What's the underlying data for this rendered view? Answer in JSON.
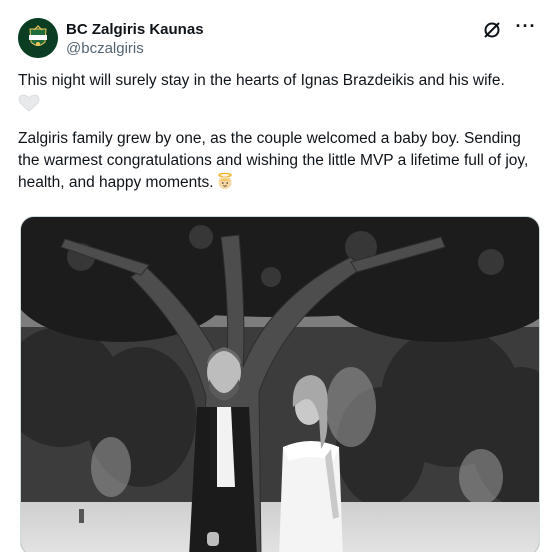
{
  "account": {
    "display_name": "BC Zalgiris Kaunas",
    "handle": "@bczalgiris",
    "avatar_text": "ZALGIRIS",
    "avatar_color": "#0b3d22"
  },
  "header_icons": {
    "grok": "grok-slash-icon",
    "more": "more-options-icon",
    "more_glyph": "···"
  },
  "tweet": {
    "paragraph1": "This night will surely stay in the hearts of Ignas Brazdeikis and his wife.",
    "paragraph1_emoji": "white-heart-icon",
    "paragraph2": "Zalgiris family grew by one, as the couple welcomed a baby boy. Sending the warmest congratulations and wishing the little MVP a lifetime full of joy, health, and happy moments.",
    "paragraph2_emoji": "baby-angel-icon"
  },
  "media": {
    "type": "photo",
    "style": "black-and-white",
    "subject": "couple-under-tree"
  }
}
